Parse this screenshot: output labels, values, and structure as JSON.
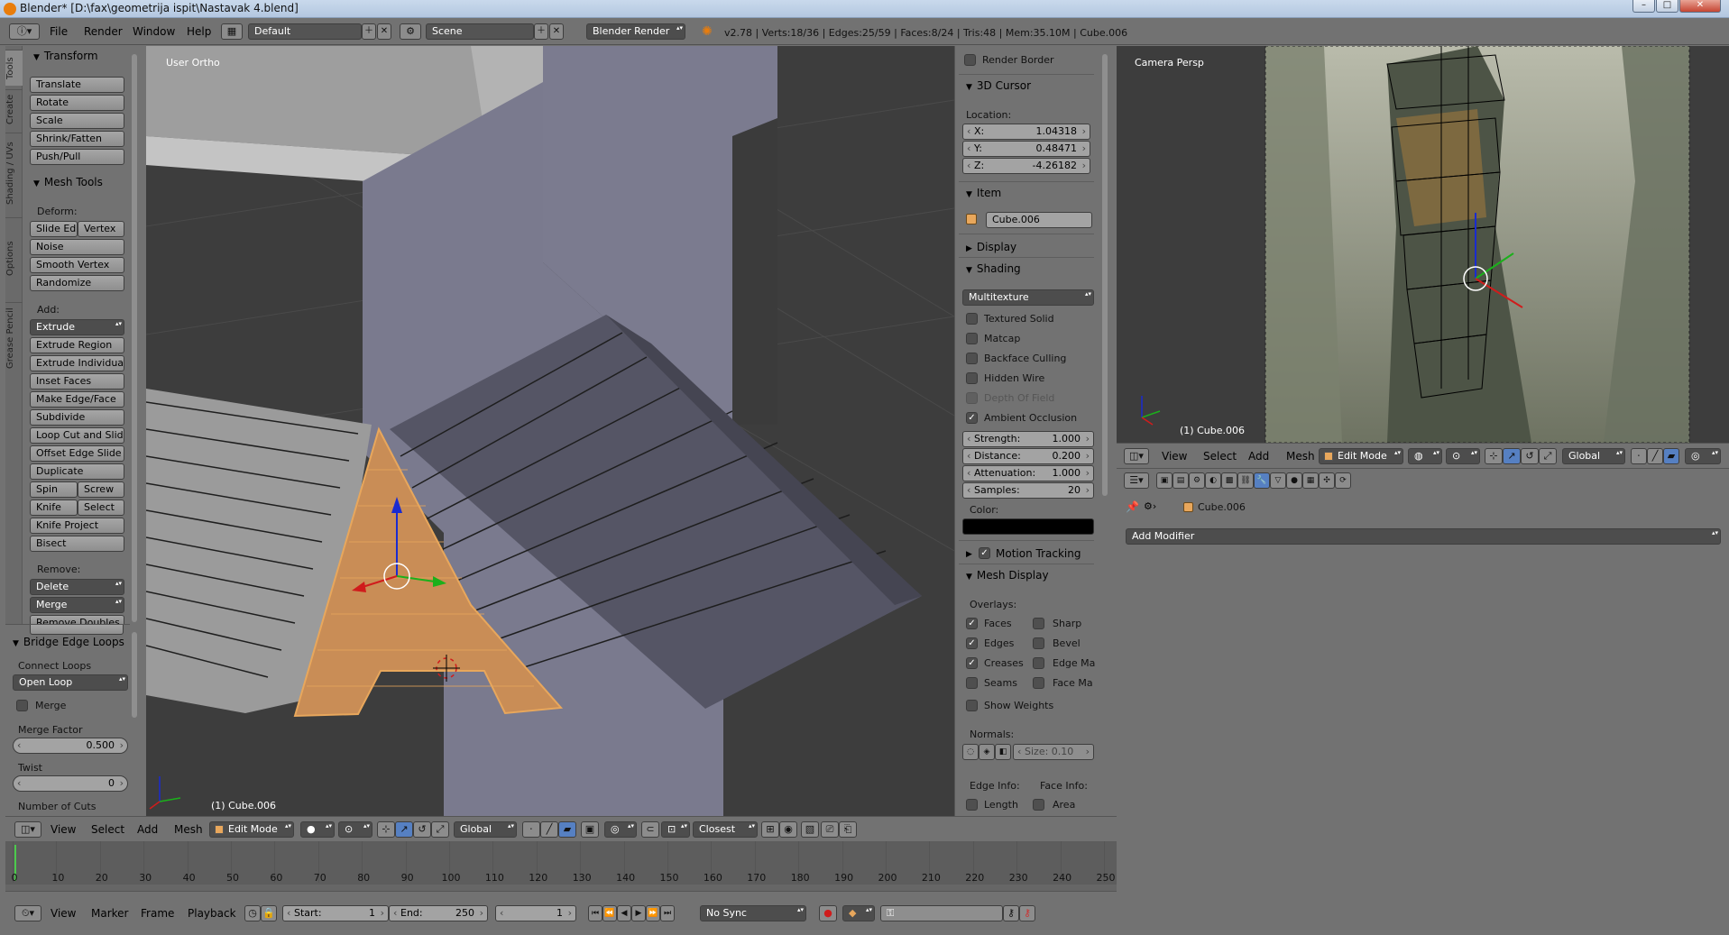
{
  "window": {
    "title": "Blender* [D:\\fax\\geometrija ispit\\Nastavak 4.blend]",
    "minimize": "–",
    "maximize": "□",
    "close": "✕"
  },
  "topbar": {
    "menus": [
      "File",
      "Render",
      "Window",
      "Help"
    ],
    "screen_layout": "Default",
    "scene": "Scene",
    "engine": "Blender Render",
    "stats": "v2.78 | Verts:18/36 | Edges:25/59 | Faces:8/24 | Tris:48 | Mem:35.10M | Cube.006"
  },
  "toolstrip": {
    "tabs": [
      "Tools",
      "Create",
      "Shading / UVs",
      "Options",
      "Grease Pencil"
    ]
  },
  "tools": {
    "transform": {
      "title": "Transform",
      "buttons": [
        "Translate",
        "Rotate",
        "Scale",
        "Shrink/Fatten",
        "Push/Pull"
      ]
    },
    "mesh_tools": {
      "title": "Mesh Tools",
      "deform_label": "Deform:",
      "slide_edge": "Slide Ed",
      "vertex": "Vertex",
      "noise": "Noise",
      "smooth_vertex": "Smooth Vertex",
      "randomize": "Randomize",
      "add_label": "Add:",
      "extrude": "Extrude",
      "extrude_region": "Extrude Region",
      "extrude_individual": "Extrude Individual",
      "inset_faces": "Inset Faces",
      "make_edge_face": "Make Edge/Face",
      "subdivide": "Subdivide",
      "loop_cut_slide": "Loop Cut and Slide",
      "offset_edge_slide": "Offset Edge Slide",
      "duplicate": "Duplicate",
      "spin": "Spin",
      "screw": "Screw",
      "knife": "Knife",
      "select": "Select",
      "knife_project": "Knife Project",
      "bisect": "Bisect",
      "remove_label": "Remove:",
      "delete": "Delete",
      "merge": "Merge",
      "remove_doubles": "Remove Doubles"
    }
  },
  "redo_panel": {
    "title": "Bridge Edge Loops",
    "connect_loops_label": "Connect Loops",
    "connect_loops_value": "Open Loop",
    "merge_label": "Merge",
    "merge_factor_label": "Merge Factor",
    "merge_factor_value": "0.500",
    "twist_label": "Twist",
    "twist_value": "0",
    "number_of_cuts_label": "Number of Cuts"
  },
  "viewport": {
    "view_label": "User Ortho",
    "object_label": "(1) Cube.006"
  },
  "npanel": {
    "render_border": "Render Border",
    "cursor_title": "3D Cursor",
    "location_label": "Location:",
    "x_label": "X:",
    "x_value": "1.04318",
    "y_label": "Y:",
    "y_value": "0.48471",
    "z_label": "Z:",
    "z_value": "-4.26182",
    "item_title": "Item",
    "item_name": "Cube.006",
    "display_title": "Display",
    "shading_title": "Shading",
    "shading_mode": "Multitexture",
    "textured_solid": "Textured Solid",
    "matcap": "Matcap",
    "backface_culling": "Backface Culling",
    "hidden_wire": "Hidden Wire",
    "depth_of_field": "Depth Of Field",
    "ambient_occlusion": "Ambient Occlusion",
    "strength_label": "Strength:",
    "strength_value": "1.000",
    "distance_label": "Distance:",
    "distance_value": "0.200",
    "attenuation_label": "Attenuation:",
    "attenuation_value": "1.000",
    "samples_label": "Samples:",
    "samples_value": "20",
    "color_label": "Color:",
    "ao_color": "#000000",
    "motion_tracking": "Motion Tracking",
    "mesh_display_title": "Mesh Display",
    "overlays_label": "Overlays:",
    "faces": "Faces",
    "sharp": "Sharp",
    "edges": "Edges",
    "bevel": "Bevel",
    "creases": "Creases",
    "edge_marks": "Edge Ma",
    "seams": "Seams",
    "face_marks": "Face Ma",
    "show_weights": "Show Weights",
    "normals_label": "Normals:",
    "normals_size": "Size:  0.10",
    "edge_info_label": "Edge Info:",
    "face_info_label": "Face Info:",
    "length": "Length",
    "area": "Area"
  },
  "view3d_header": {
    "menus": [
      "View",
      "Select",
      "Add",
      "Mesh"
    ],
    "mode": "Edit Mode",
    "orientation": "Global",
    "snap": "Closest"
  },
  "timeline": {
    "ticks": [
      "0",
      "10",
      "20",
      "30",
      "40",
      "50",
      "60",
      "70",
      "80",
      "90",
      "100",
      "110",
      "120",
      "130",
      "140",
      "150",
      "160",
      "170",
      "180",
      "190",
      "200",
      "210",
      "220",
      "230",
      "240",
      "250"
    ],
    "menus": [
      "View",
      "Marker",
      "Frame",
      "Playback"
    ],
    "start_label": "Start:",
    "start_value": "1",
    "end_label": "End:",
    "end_value": "250",
    "current_frame": "1",
    "sync": "No Sync"
  },
  "camera_view": {
    "view_label": "Camera Persp",
    "object_label": "(1) Cube.006"
  },
  "camera_header": {
    "menus": [
      "View",
      "Select",
      "Add",
      "Mesh"
    ],
    "mode": "Edit Mode",
    "orientation": "Global"
  },
  "properties": {
    "breadcrumb_object": "Cube.006",
    "add_modifier": "Add Modifier"
  },
  "colors": {
    "selection_orange": "#e8a75c",
    "viewport_bg": "#3d3d3d",
    "panel_bg": "#727272"
  }
}
